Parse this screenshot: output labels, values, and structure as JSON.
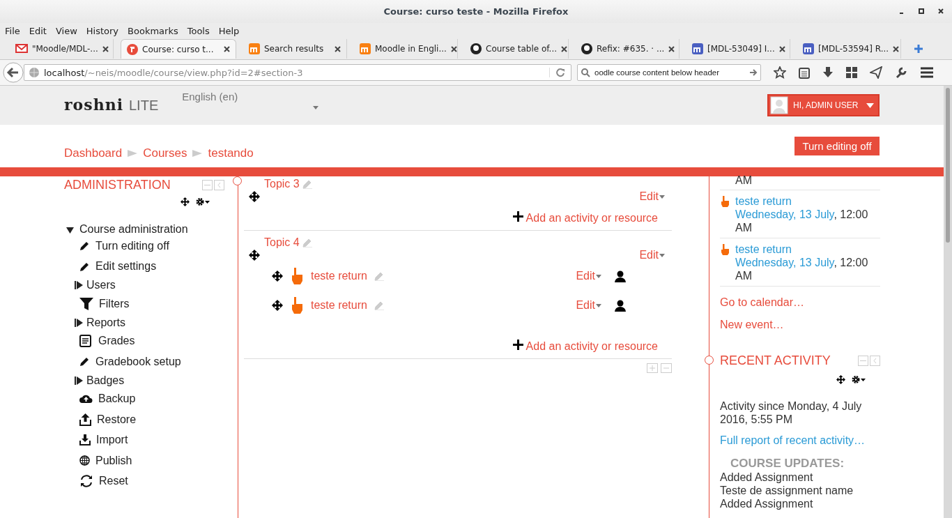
{
  "window": {
    "title": "Course: curso teste - Mozilla Firefox"
  },
  "menu": [
    "File",
    "Edit",
    "View",
    "History",
    "Bookmarks",
    "Tools",
    "Help"
  ],
  "tabs": [
    {
      "label": "\"Moodle/MDL-...",
      "selected": false
    },
    {
      "label": "Course: curso t...",
      "selected": true
    },
    {
      "label": "Search results",
      "selected": false
    },
    {
      "label": "Moodle in Engli...",
      "selected": false
    },
    {
      "label": "Course table of...",
      "selected": false
    },
    {
      "label": "Refix: #635. · ...",
      "selected": false
    },
    {
      "label": "[MDL-53049] I...",
      "selected": false
    },
    {
      "label": "[MDL-53594] R...",
      "selected": false
    }
  ],
  "navbar": {
    "url_host": "localhost",
    "url_path": "/~neis/moodle/course/view.php?id=2#section-3",
    "search": "oodle course content below header"
  },
  "site": {
    "logo": "roshni",
    "logo_suffix": "LITE",
    "language": "English (en)",
    "user": "HI, ADMIN USER"
  },
  "breadcrumb": [
    "Dashboard",
    "Courses",
    "testando"
  ],
  "edit_button": "Turn editing off",
  "admin": {
    "title": "ADMINISTRATION",
    "section": "Course administration",
    "expanded": true,
    "items": [
      {
        "label": "Turn editing off",
        "kind": "link"
      },
      {
        "label": "Edit settings",
        "kind": "link"
      },
      {
        "label": "Users",
        "kind": "folder"
      },
      {
        "label": "Filters",
        "kind": "link"
      },
      {
        "label": "Reports",
        "kind": "folder"
      },
      {
        "label": "Grades",
        "kind": "link"
      },
      {
        "label": "Gradebook setup",
        "kind": "link"
      },
      {
        "label": "Badges",
        "kind": "folder"
      },
      {
        "label": "Backup",
        "kind": "link"
      },
      {
        "label": "Restore",
        "kind": "link"
      },
      {
        "label": "Import",
        "kind": "link"
      },
      {
        "label": "Publish",
        "kind": "link"
      },
      {
        "label": "Reset",
        "kind": "link"
      }
    ]
  },
  "topics": [
    {
      "title": "Topic 3",
      "edit": "Edit",
      "add": "Add an activity or resource"
    },
    {
      "title": "Topic 4",
      "edit": "Edit",
      "add": "Add an activity or resource",
      "activities": [
        {
          "name": "teste return",
          "edit": "Edit"
        },
        {
          "name": "teste return",
          "edit": "Edit"
        }
      ]
    }
  ],
  "events": {
    "partial": "AM",
    "items": [
      {
        "name": "teste return",
        "date": "Wednesday, 13 July",
        "time": ", 12:00 AM"
      },
      {
        "name": "teste return",
        "date": "Wednesday, 13 July",
        "time": ", 12:00 AM"
      }
    ],
    "links": [
      "Go to calendar…",
      "New event…"
    ]
  },
  "recent": {
    "title": "RECENT ACTIVITY",
    "since": "Activity since Monday, 4 July 2016, 5:55 PM",
    "report": "Full report of recent activity…",
    "updates_title": "COURSE UPDATES:",
    "updates": [
      "Added Assignment",
      "Teste de assignment name",
      "Added Assignment"
    ]
  }
}
